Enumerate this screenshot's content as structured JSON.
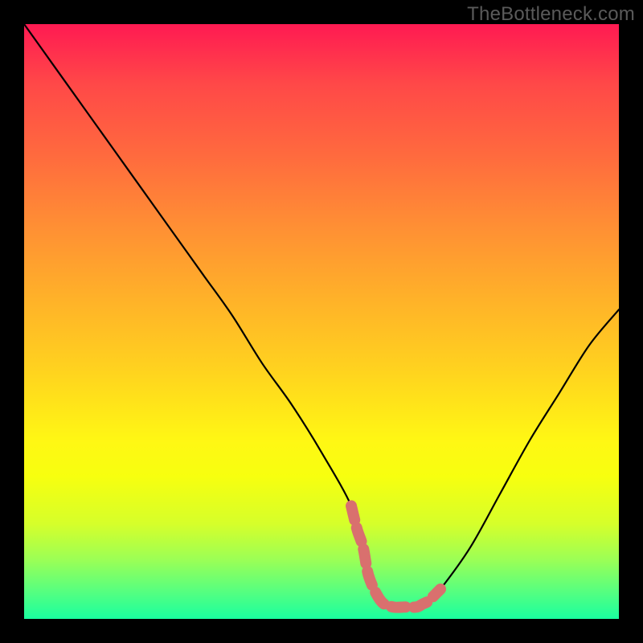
{
  "watermark": "TheBottleneck.com",
  "chart_data": {
    "type": "line",
    "title": "",
    "xlabel": "",
    "ylabel": "",
    "x_range": [
      0,
      100
    ],
    "y_range": [
      0,
      100
    ],
    "series": [
      {
        "name": "bottleneck-curve",
        "color": "#000000",
        "x": [
          0,
          5,
          10,
          15,
          20,
          25,
          30,
          35,
          40,
          45,
          50,
          55,
          57,
          59,
          60,
          62,
          64,
          66,
          68,
          70,
          75,
          80,
          85,
          90,
          95,
          100
        ],
        "values": [
          100,
          93,
          86,
          79,
          72,
          65,
          58,
          51,
          43,
          36,
          28,
          19,
          12,
          5,
          3,
          2,
          2,
          2,
          3,
          5,
          12,
          21,
          30,
          38,
          46,
          52
        ]
      },
      {
        "name": "optimal-marker",
        "color": "#d9706e",
        "x": [
          55,
          56,
          57,
          58,
          60,
          62,
          64,
          66,
          67,
          68,
          69,
          70
        ],
        "values": [
          19,
          15,
          12,
          7,
          3,
          2,
          2,
          2,
          2.5,
          3,
          4,
          5
        ]
      }
    ],
    "annotations": []
  }
}
